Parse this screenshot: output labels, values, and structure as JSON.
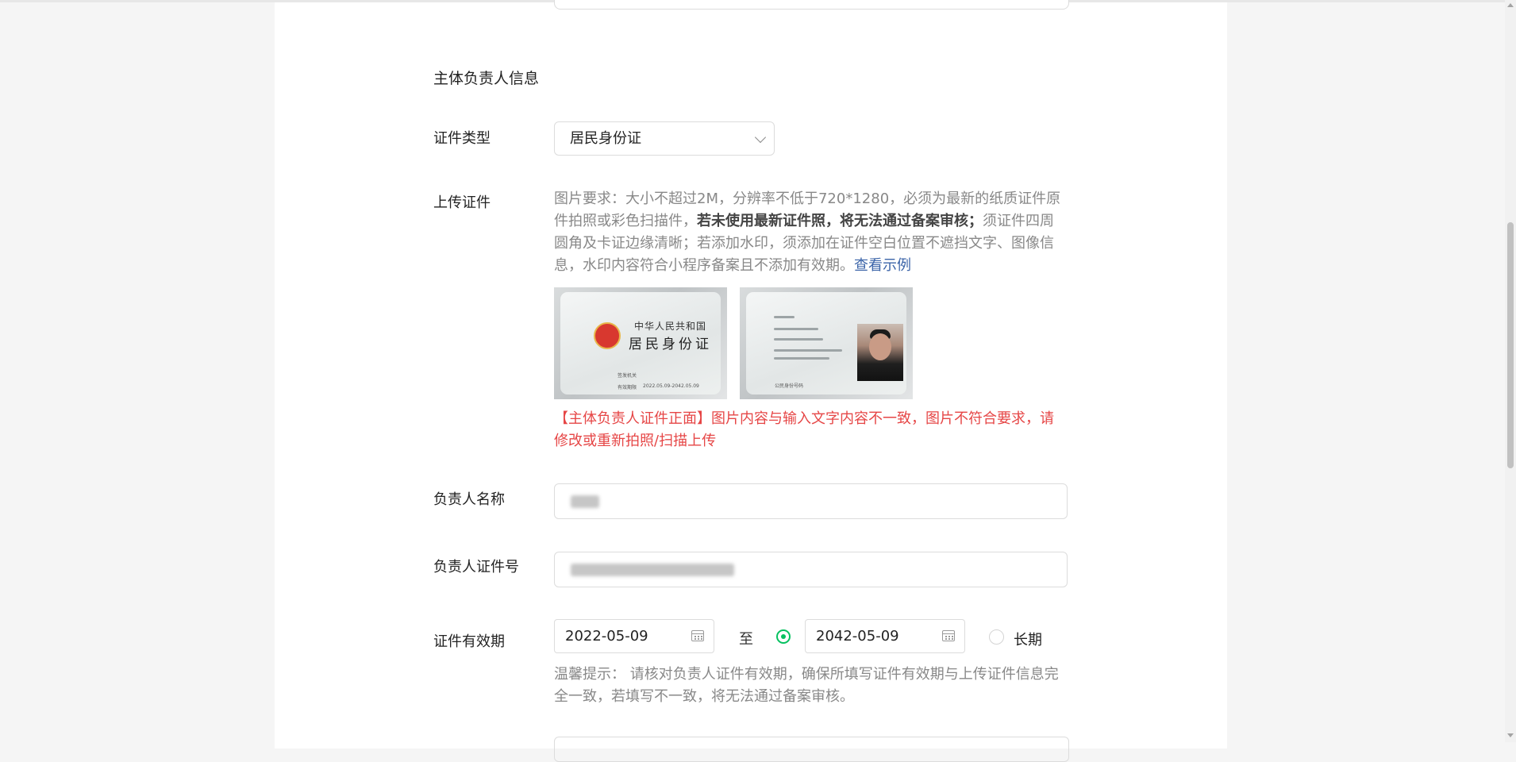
{
  "section": {
    "title": "主体负责人信息"
  },
  "cert_type": {
    "label": "证件类型",
    "value": "居民身份证"
  },
  "upload": {
    "label": "上传证件",
    "req_part1": "图片要求：大小不超过2M，分辨率不低于720*1280，必须为最新的纸质证件原件拍照或彩色扫描件，",
    "req_bold": "若未使用最新证件照，将无法通过备案审核；",
    "req_part2": "须证件四周圆角及卡证边缘清晰；若添加水印，须添加在证件空白位置不遮挡文字、图像信息，水印内容符合小程序备案且不添加有效期。",
    "example_link": "查看示例",
    "front_card": {
      "title_line1": "中华人民共和国",
      "title_line2": "居民身份证",
      "issuer_label": "签发机关",
      "validity_label": "有效期限",
      "validity_value": "2022.05.09-2042.05.09"
    },
    "back_card": {
      "id_number_label": "公民身份号码"
    },
    "error": "【主体负责人证件正面】图片内容与输入文字内容不一致，图片不符合要求，请修改或重新拍照/扫描上传"
  },
  "name_field": {
    "label": "负责人名称"
  },
  "id_field": {
    "label": "负责人证件号"
  },
  "validity": {
    "label": "证件有效期",
    "start": "2022-05-09",
    "to": "至",
    "end": "2042-05-09",
    "long_term": "长期"
  },
  "tip": "温馨提示： 请核对负责人证件有效期，确保所填写证件有效期与上传证件信息完全一致，若填写不一致，将无法通过备案审核。",
  "colors": {
    "accent": "#07c160",
    "error": "#e64646",
    "link": "#3b64a8"
  }
}
